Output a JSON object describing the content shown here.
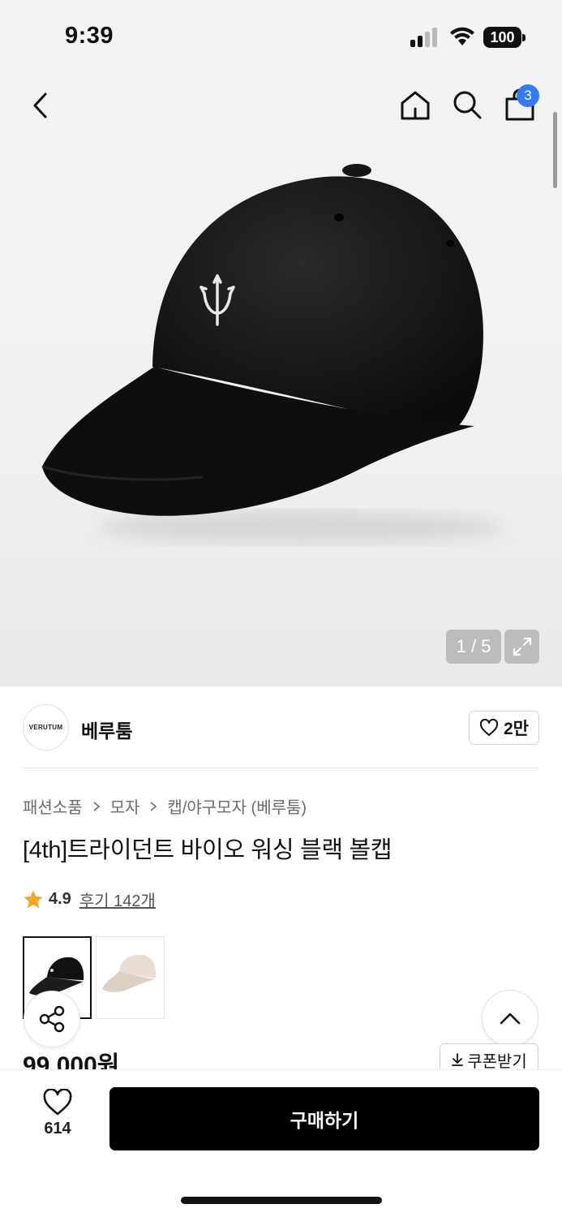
{
  "status_bar": {
    "time": "9:39",
    "battery": "100"
  },
  "nav": {
    "cart_count": "3"
  },
  "gallery": {
    "counter": "1 / 5"
  },
  "brand": {
    "name": "베루툼",
    "logo_text": "VERUTUM",
    "like_count": "2만"
  },
  "breadcrumb": [
    "패션소품",
    "모자",
    "캡/야구모자 (베루툼)"
  ],
  "product": {
    "title": "[4th]트라이던트 바이오 워싱 블랙 볼캡",
    "rating": "4.9",
    "reviews": "후기 142개",
    "price": "99,000원"
  },
  "actions": {
    "coupon_label": "쿠폰받기",
    "wish_count": "614",
    "buy_label": "구매하기"
  },
  "icons": [
    "back-icon",
    "home-icon",
    "search-icon",
    "cart-icon",
    "expand-icon",
    "heart-icon",
    "star-icon",
    "share-icon",
    "chevron-up-icon",
    "download-icon"
  ],
  "colors": {
    "badge": "#2f7cf6",
    "star": "#f5a623",
    "buy_button": "#000000"
  }
}
